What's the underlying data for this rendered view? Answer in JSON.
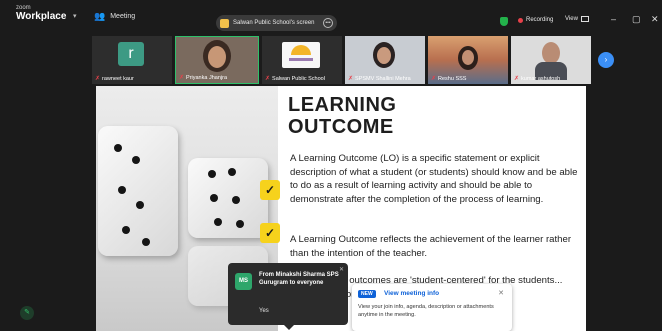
{
  "app": {
    "logo_line1": "zoom",
    "logo_line2": "Workplace"
  },
  "header": {
    "meeting_label": "Meeting",
    "share_label": "Salwan Public School's screen",
    "recording_label": "Recording",
    "view_label": "View"
  },
  "participants": [
    {
      "name": "rawneet kaur",
      "initial": "r"
    },
    {
      "name": "Priyanka Jhanjra"
    },
    {
      "name": "Salwan Public School"
    },
    {
      "name": "SPSMV Shallini Mehra"
    },
    {
      "name": "Reshu SSS"
    },
    {
      "name": "kumar ashutosh"
    }
  ],
  "slide": {
    "title_line1": "LEARNING",
    "title_line2": "OUTCOME",
    "para1": "A Learning Outcome (LO) is a specific statement or explicit description of what a student (or students) should know and be able to do as a result of learning activity and should be able to demonstrate after the completion of the process of learning.",
    "para2": "A Learning Outcome reflects the achievement of the learner rather than the intention of the teacher.",
    "para3": "The Learning outcomes are 'student-centered' for the students...                      ...'learnings' for",
    "accent_color": "#f6d21c"
  },
  "chat_popup": {
    "initials": "MS",
    "from": "From Minakshi Sharma SPS Gurugram to everyone",
    "message": "Yes"
  },
  "meeting_info": {
    "badge": "NEW",
    "title": "View meeting info",
    "body": "View your join info, agenda, description or attachments anytime in the meeting."
  }
}
